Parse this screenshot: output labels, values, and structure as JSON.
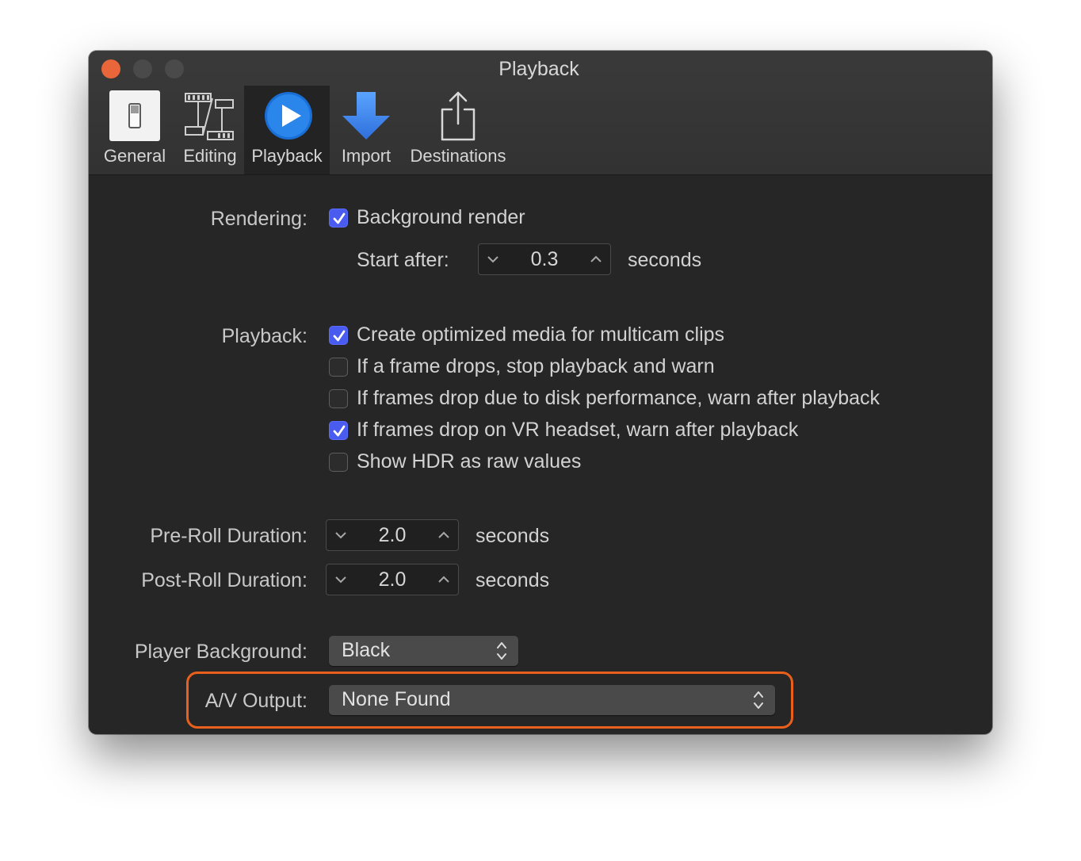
{
  "window": {
    "title": "Playback"
  },
  "toolbar": {
    "items": [
      {
        "label": "General",
        "icon": "general-switch-icon"
      },
      {
        "label": "Editing",
        "icon": "film-strip-icon"
      },
      {
        "label": "Playback",
        "icon": "play-circle-icon",
        "active": true
      },
      {
        "label": "Import",
        "icon": "download-arrow-icon"
      },
      {
        "label": "Destinations",
        "icon": "share-icon"
      }
    ]
  },
  "rendering": {
    "label": "Rendering:",
    "background_render": {
      "label": "Background render",
      "checked": true
    },
    "start_after": {
      "label": "Start after:",
      "value": "0.3",
      "unit": "seconds"
    }
  },
  "playback": {
    "label": "Playback:",
    "options": [
      {
        "label": "Create optimized media for multicam clips",
        "checked": true
      },
      {
        "label": "If a frame drops, stop playback and warn",
        "checked": false
      },
      {
        "label": "If frames drop due to disk performance, warn after playback",
        "checked": false
      },
      {
        "label": "If frames drop on VR headset, warn after playback",
        "checked": true
      },
      {
        "label": "Show HDR as raw values",
        "checked": false
      }
    ]
  },
  "preroll": {
    "label": "Pre-Roll Duration:",
    "value": "2.0",
    "unit": "seconds"
  },
  "postroll": {
    "label": "Post-Roll Duration:",
    "value": "2.0",
    "unit": "seconds"
  },
  "player_background": {
    "label": "Player Background:",
    "value": "Black"
  },
  "av_output": {
    "label": "A/V Output:",
    "value": "None Found"
  },
  "colors": {
    "accent": "#4a5cf0",
    "highlight": "#e8601c",
    "close": "#e9653a"
  }
}
